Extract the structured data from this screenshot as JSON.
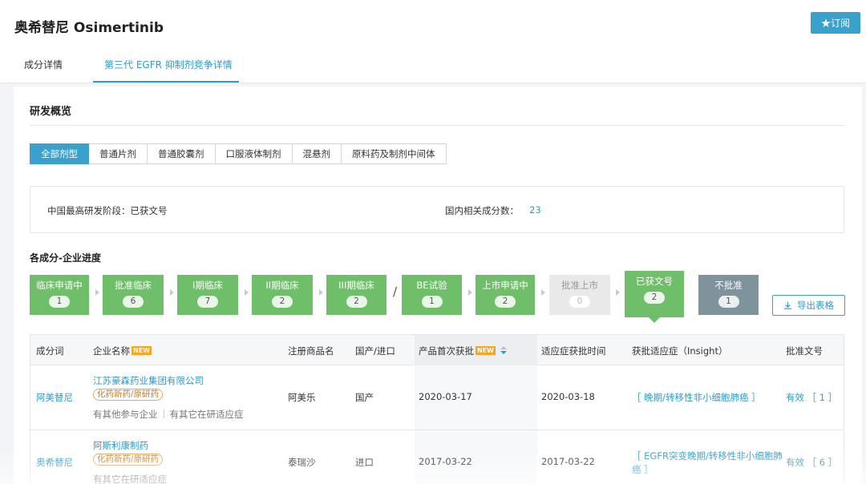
{
  "header": {
    "title": "奥希替尼 Osimertinib",
    "subscribe_label": "★订阅",
    "tabs": [
      {
        "label": "成分详情"
      },
      {
        "label": "第三代 EGFR 抑制剂竞争详情"
      }
    ]
  },
  "overview": {
    "title": "研发概览",
    "filters": [
      "全部剂型",
      "普通片剂",
      "普通胶囊剂",
      "口服液体制剂",
      "混悬剂",
      "原料药及制剂中间体"
    ],
    "info": {
      "highest_stage_label": "中国最高研发阶段：已获文号",
      "related_count_label": "国内相关成分数：",
      "related_count_value": "23"
    }
  },
  "progress": {
    "title": "各成分-企业进度",
    "stages": [
      {
        "name": "临床申请中",
        "count": "1"
      },
      {
        "name": "批准临床",
        "count": "6"
      },
      {
        "name": "I期临床",
        "count": "7"
      },
      {
        "name": "II期临床",
        "count": "2"
      },
      {
        "name": "III期临床",
        "count": "2"
      },
      {
        "name": "BE试验",
        "count": "1"
      },
      {
        "name": "上市申请中",
        "count": "2"
      },
      {
        "name": "批准上市",
        "count": "0"
      },
      {
        "name": "已获文号",
        "count": "2"
      },
      {
        "name": "不批准",
        "count": "1"
      }
    ],
    "separator": "/",
    "export_label": "导出表格"
  },
  "table": {
    "new_tag": "NEW",
    "columns": [
      "成分词",
      "企业名称",
      "注册商品名",
      "国产/进口",
      "产品首次获批",
      "适应症获批时间",
      "获批适应症（Insight）",
      "批准文号"
    ],
    "rows": [
      {
        "ingredient": "阿美替尼",
        "company": "江苏豪森药业集团有限公司",
        "badge": "化药新药/原研药",
        "links": [
          "有其他参与企业",
          "有其它在研适应症"
        ],
        "brand": "阿美乐",
        "origin": "国产",
        "first_approval": "2020-03-17",
        "indication_date": "2020-03-18",
        "indication": [
          "［ 晚期/转移性非小细胞肺癌 ］"
        ],
        "approval": "有效 ［ 1 ］"
      },
      {
        "ingredient": "奥希替尼",
        "company": "阿斯利康制药",
        "badge": "化药新药/原研药",
        "links": [
          "有其它在研适应症"
        ],
        "brand": "泰瑞沙",
        "origin": "进口",
        "first_approval": "2017-03-22",
        "indication_date": "2017-03-22",
        "indication": [
          "［ EGFR突变晚期/转移性非小细胞肺",
          "癌 ］"
        ],
        "approval": "有效 ［ 6 ］"
      }
    ]
  }
}
